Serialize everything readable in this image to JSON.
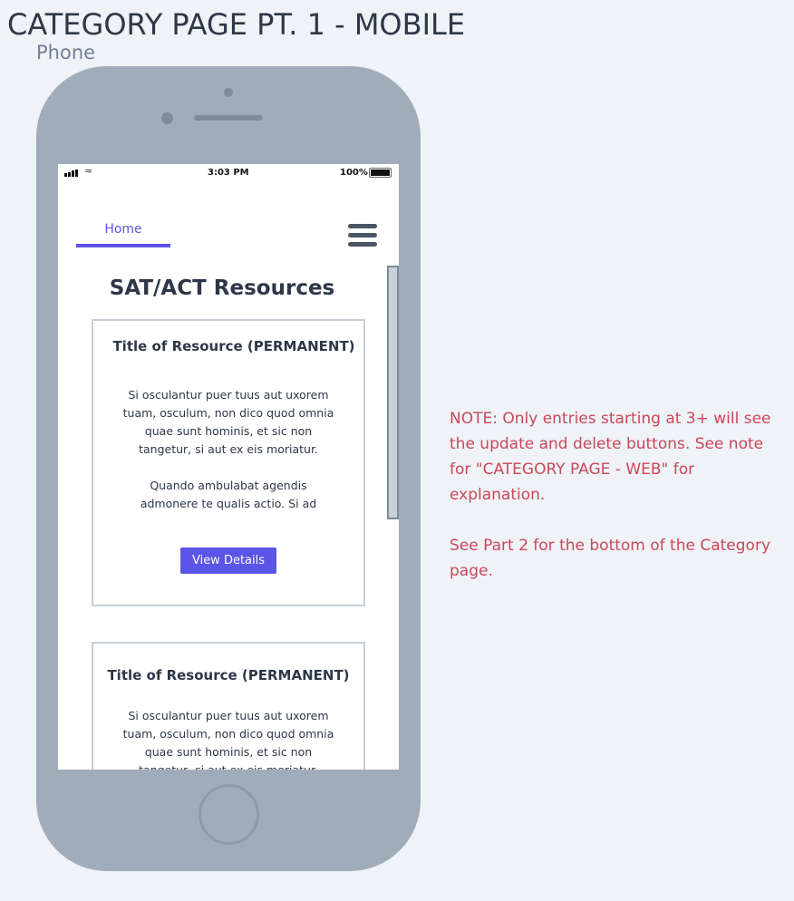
{
  "page_title": "CATEGORY PAGE PT. 1 - MOBILE",
  "frame_label": "Phone",
  "status_bar": {
    "time": "3:03 PM",
    "battery": "100%"
  },
  "nav": {
    "home_label": "Home"
  },
  "heading": "SAT/ACT Resources",
  "cards": [
    {
      "title": "Title of Resource (PERMANENT)",
      "paragraphs": [
        "Si osculantur puer tuus aut uxorem tuam, osculum, non dico quod omnia quae sunt hominis, et sic non tangetur, si aut ex eis moriatur.",
        "Quando ambulabat agendis admonere te qualis actio. Si ad"
      ],
      "button": "View Details"
    },
    {
      "title": "Title of Resource (PERMANENT)",
      "paragraphs": [
        "Si osculantur puer tuus aut uxorem tuam, osculum, non dico quod omnia quae sunt hominis, et sic non tangetur, si aut ex eis moriatur."
      ]
    }
  ],
  "note": {
    "line1": "NOTE: Only entries starting at 3+ will see the update and delete buttons. See note for \"CATEGORY PAGE - WEB\" for explanation.",
    "line2": "See Part 2 for the bottom of the Category page."
  },
  "colors": {
    "accent": "#5a55e6",
    "note": "#c8485a",
    "phone": "#a0acb9"
  }
}
